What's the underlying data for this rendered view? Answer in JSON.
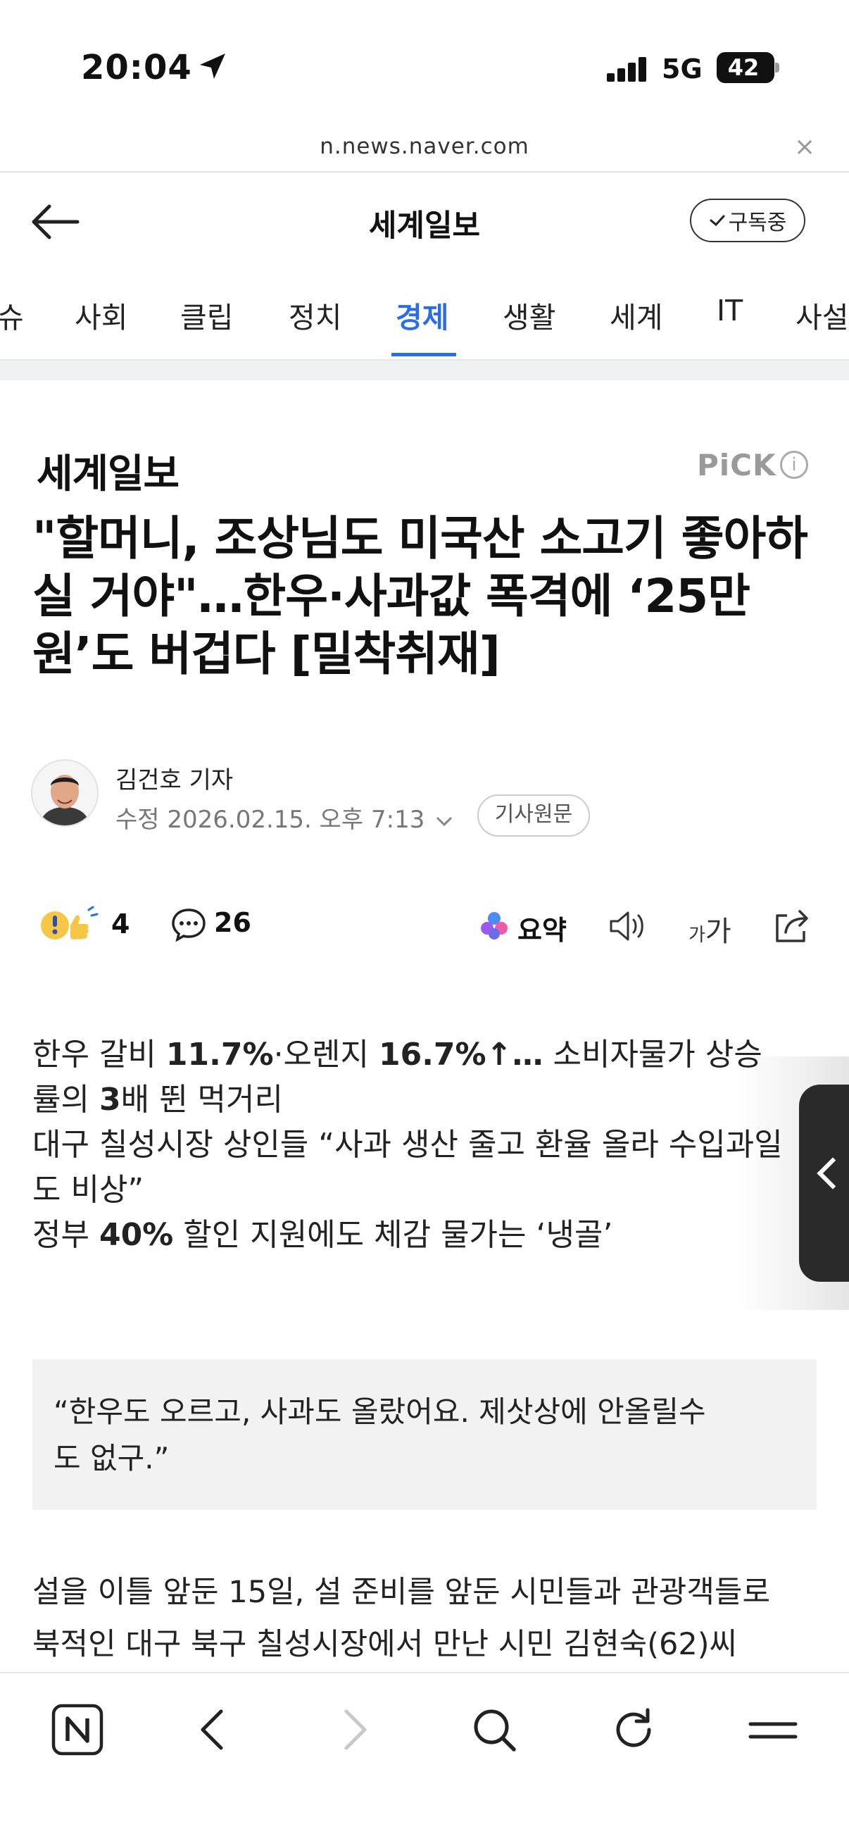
{
  "status_bar": {
    "time": "20:04",
    "network": "5G",
    "battery": "42"
  },
  "browser": {
    "url": "n.news.naver.com",
    "close_label": "×"
  },
  "header": {
    "press_name": "세계일보",
    "subscribe_label": "구독중"
  },
  "tabs": [
    {
      "label": "슈"
    },
    {
      "label": "사회"
    },
    {
      "label": "클립"
    },
    {
      "label": "정치"
    },
    {
      "label": "경제",
      "active": true
    },
    {
      "label": "생활"
    },
    {
      "label": "세계"
    },
    {
      "label": "IT"
    },
    {
      "label": "사설"
    }
  ],
  "article": {
    "press_logo": "세계일보",
    "pick_label": "PiCK",
    "info_label": "i",
    "headline": "\"할머니, 조상님도 미국산 소고기 좋아하실 거야\"…한우·사과값 폭격에 ‘25만원’도 버겁다 [밀착취재]",
    "reporter": "김건호 기자",
    "modified": "수정 2026.02.15. 오후 7:13",
    "original_label": "기사원문",
    "reaction_count": "4",
    "comment_count": "26",
    "summary_label": "요약",
    "fontsize_small": "가",
    "fontsize_large": "가",
    "summary_lines": [
      [
        "한우 갈비 ",
        "11.7%",
        "·오렌지 ",
        "16.7%↑…",
        " 소비자물가 상승"
      ],
      [
        "률의 ",
        "3",
        "배 뛴 먹거리"
      ],
      [
        "대구 칠성시장 상인들 “사과 생산 줄고 환율 올라 수입과일"
      ],
      [
        "도 비상”"
      ],
      [
        "정부 ",
        "40%",
        " 할인 지원에도 체감 물가는 ‘냉골’"
      ]
    ],
    "quote_line1": "“한우도 오르고, 사과도 올랐어요. 제삿상에 안올릴수",
    "quote_line2": "도 없구.”",
    "body_line1": "설을 이틀 앞둔 15일, 설 준비를 앞둔 시민들과 관광객들로",
    "body_line2": "북적인 대구 북구 칠성시장에서 만난 시민 김현숙(62)씨"
  },
  "colors": {
    "accent": "#2a6de8",
    "pick_gray": "#9a9a9a"
  }
}
